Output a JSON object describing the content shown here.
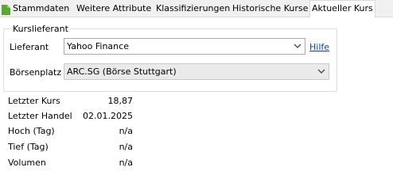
{
  "tabs": [
    {
      "label": "Stammdaten",
      "active": false,
      "icon": "document-icon"
    },
    {
      "label": "Weitere Attribute",
      "active": false
    },
    {
      "label": "Klassifizierungen",
      "active": false
    },
    {
      "label": "Historische Kurse",
      "active": false
    },
    {
      "label": "Aktueller Kurs",
      "active": true
    }
  ],
  "kurslieferant": {
    "title": "Kurslieferant",
    "lieferant_label": "Lieferant",
    "lieferant_value": "Yahoo Finance",
    "hilfe_link": "Hilfe",
    "boersenplatz_label": "Börsenplatz",
    "boersenplatz_value": "ARC.SG (Börse Stuttgart)"
  },
  "quote": {
    "rows": [
      {
        "label": "Letzter Kurs",
        "value": "18,87"
      },
      {
        "label": "Letzter Handel",
        "value": "02.01.2025"
      },
      {
        "label": "Hoch (Tag)",
        "value": "n/a"
      },
      {
        "label": "Tief (Tag)",
        "value": "n/a"
      },
      {
        "label": "Volumen",
        "value": "n/a"
      }
    ]
  },
  "colors": {
    "link": "#0645ad",
    "icon_green": "#5aa832"
  }
}
